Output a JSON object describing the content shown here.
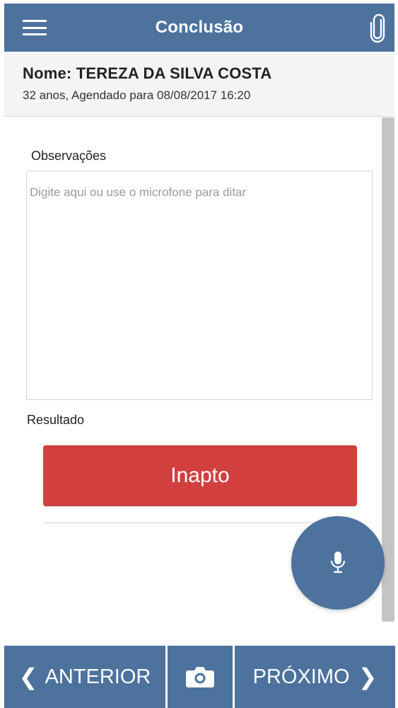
{
  "header": {
    "title": "Conclusão",
    "menu_icon": "menu-icon",
    "attach_icon": "paperclip-icon"
  },
  "patient": {
    "name": "Nome: TEREZA DA SILVA COSTA",
    "info": "32 anos, Agendado para 08/08/2017 16:20"
  },
  "form": {
    "observations_label": "Observações",
    "observations_value": "",
    "observations_placeholder": "Digite aqui ou use o microfone para ditar",
    "result_label": "Resultado",
    "result_value": "Inapto"
  },
  "fab": {
    "icon": "microphone-icon"
  },
  "footer": {
    "prev_label": "ANTERIOR",
    "next_label": "PRÓXIMO",
    "camera_icon": "camera-icon"
  },
  "colors": {
    "primary": "#4c729d",
    "danger": "#d13f3f",
    "header_bg": "#f4f4f4"
  }
}
